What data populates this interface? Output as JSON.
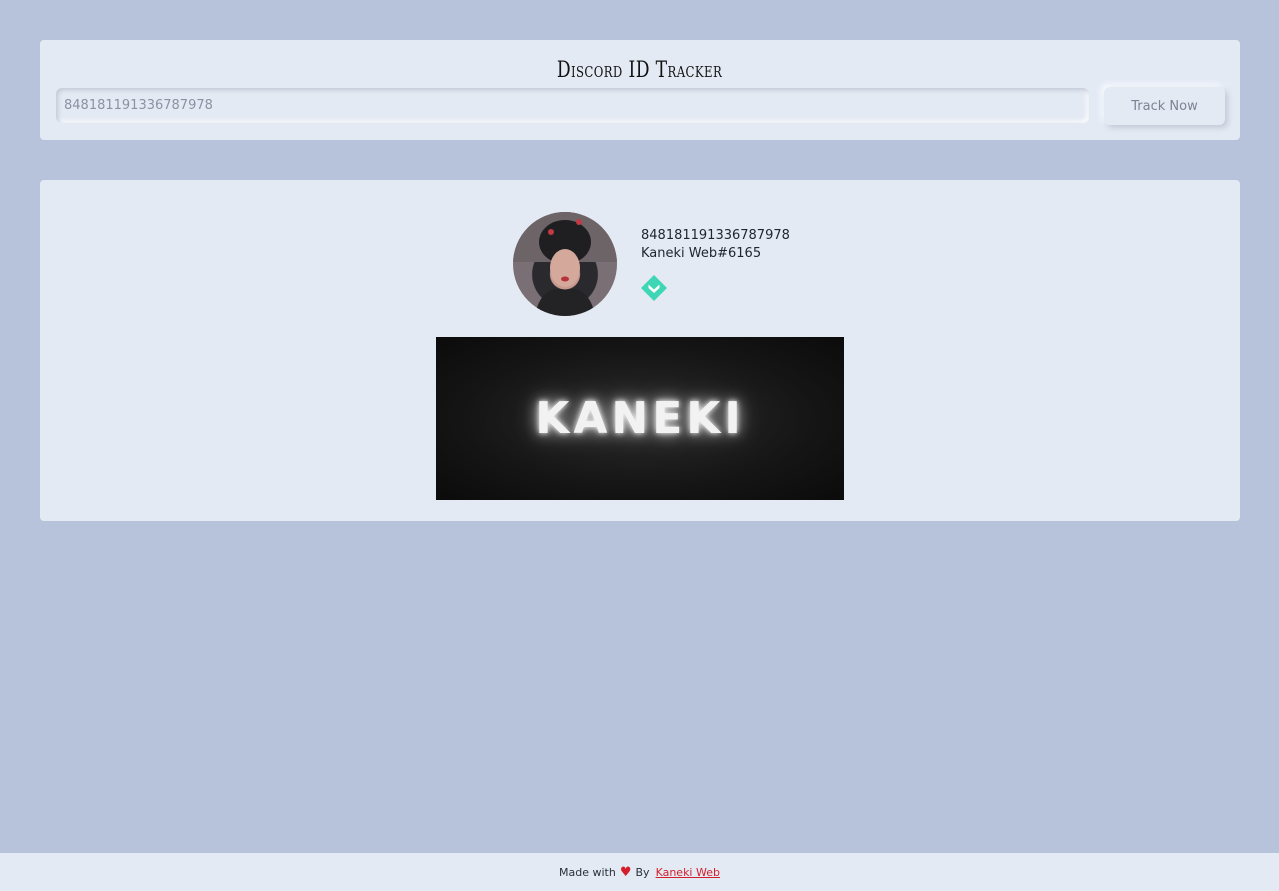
{
  "header": {
    "title": "Discord ID Tracker",
    "input_value": "848181191336787978",
    "track_button_label": "Track Now"
  },
  "profile": {
    "user_id": "848181191336787978",
    "username": "Kaneki Web#6165",
    "badge_icon": "hypesquad-balance-badge-icon",
    "banner_text": "KANEKI"
  },
  "footer": {
    "made_with": "Made with",
    "by": "By",
    "author_link": "Kaneki Web"
  },
  "colors": {
    "background": "#b7c3db",
    "card": "#e4eaf4",
    "badge": "#3ed6b4",
    "heart": "#d21f2b"
  }
}
